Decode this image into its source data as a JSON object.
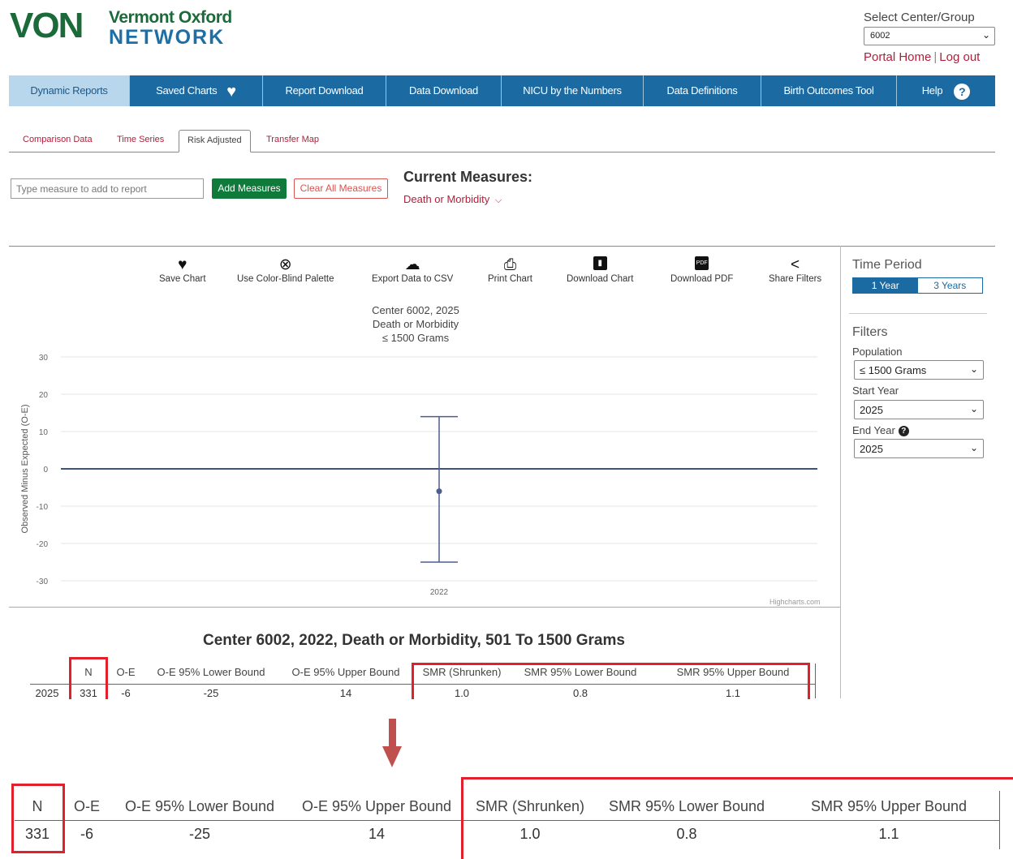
{
  "header": {
    "logo_short": "VON",
    "logo_line1": "Vermont Oxford",
    "logo_line2": "NETWORK",
    "center_label": "Select Center/Group",
    "center_value": "6002",
    "portal_home": "Portal Home",
    "logout": "Log out"
  },
  "nav": {
    "items": [
      {
        "label": "Dynamic Reports"
      },
      {
        "label": "Saved Charts"
      },
      {
        "label": "Report Download"
      },
      {
        "label": "Data Download"
      },
      {
        "label": "NICU by the Numbers"
      },
      {
        "label": "Data Definitions"
      },
      {
        "label": "Birth Outcomes Tool"
      },
      {
        "label": "Help"
      }
    ]
  },
  "tabs": [
    {
      "label": "Comparison Data"
    },
    {
      "label": "Time Series"
    },
    {
      "label": "Risk Adjusted"
    },
    {
      "label": "Transfer Map"
    }
  ],
  "measures": {
    "placeholder": "Type measure to add to report",
    "add_label": "Add Measures",
    "clear_label": "Clear All Measures",
    "current_title": "Current Measures:",
    "current_item": "Death or Morbidity"
  },
  "toolbar": {
    "save": "Save Chart",
    "palette": "Use Color-Blind Palette",
    "export": "Export Data to CSV",
    "print": "Print Chart",
    "download_chart": "Download Chart",
    "download_pdf": "Download PDF",
    "share": "Share Filters"
  },
  "chart_data": {
    "type": "scatter",
    "title_lines": [
      "Center 6002, 2025",
      "Death or Morbidity",
      "≤ 1500 Grams"
    ],
    "ylabel": "Observed Minus Expected (O-E)",
    "xlabel": "",
    "categories": [
      "2022"
    ],
    "yticks": [
      "30",
      "20",
      "10",
      "0",
      "-10",
      "-20",
      "-30"
    ],
    "ylim": [
      -30,
      30
    ],
    "series": [
      {
        "values": [
          -6
        ],
        "lower": [
          -25
        ],
        "upper": [
          14
        ]
      }
    ],
    "reference_line": 0,
    "grid": true,
    "credit": "Highcharts.com",
    "colors": {
      "line": "#4d5e8c",
      "ref": "#3f527f"
    }
  },
  "sidebar": {
    "time_period_title": "Time Period",
    "period_1": "1 Year",
    "period_3": "3 Years",
    "filters_title": "Filters",
    "population_label": "Population",
    "population_value": "≤ 1500 Grams",
    "start_label": "Start Year",
    "start_value": "2025",
    "end_label": "End Year",
    "end_value": "2025"
  },
  "table": {
    "title": "Center 6002, 2022, Death or Morbidity, 501 To 1500 Grams",
    "headers": [
      "N",
      "O-E",
      "O-E 95% Lower Bound",
      "O-E 95% Upper Bound",
      "SMR (Shrunken)",
      "SMR 95% Lower Bound",
      "SMR 95% Upper Bound"
    ],
    "row_label": "2025",
    "row": [
      "331",
      "-6",
      "-25",
      "14",
      "1.0",
      "0.8",
      "1.1"
    ]
  },
  "colors": {
    "brand_green": "#1b6b3a",
    "brand_blue": "#1c6aa2",
    "link_red": "#b01f3a",
    "highlight_red": "#e0202a"
  }
}
